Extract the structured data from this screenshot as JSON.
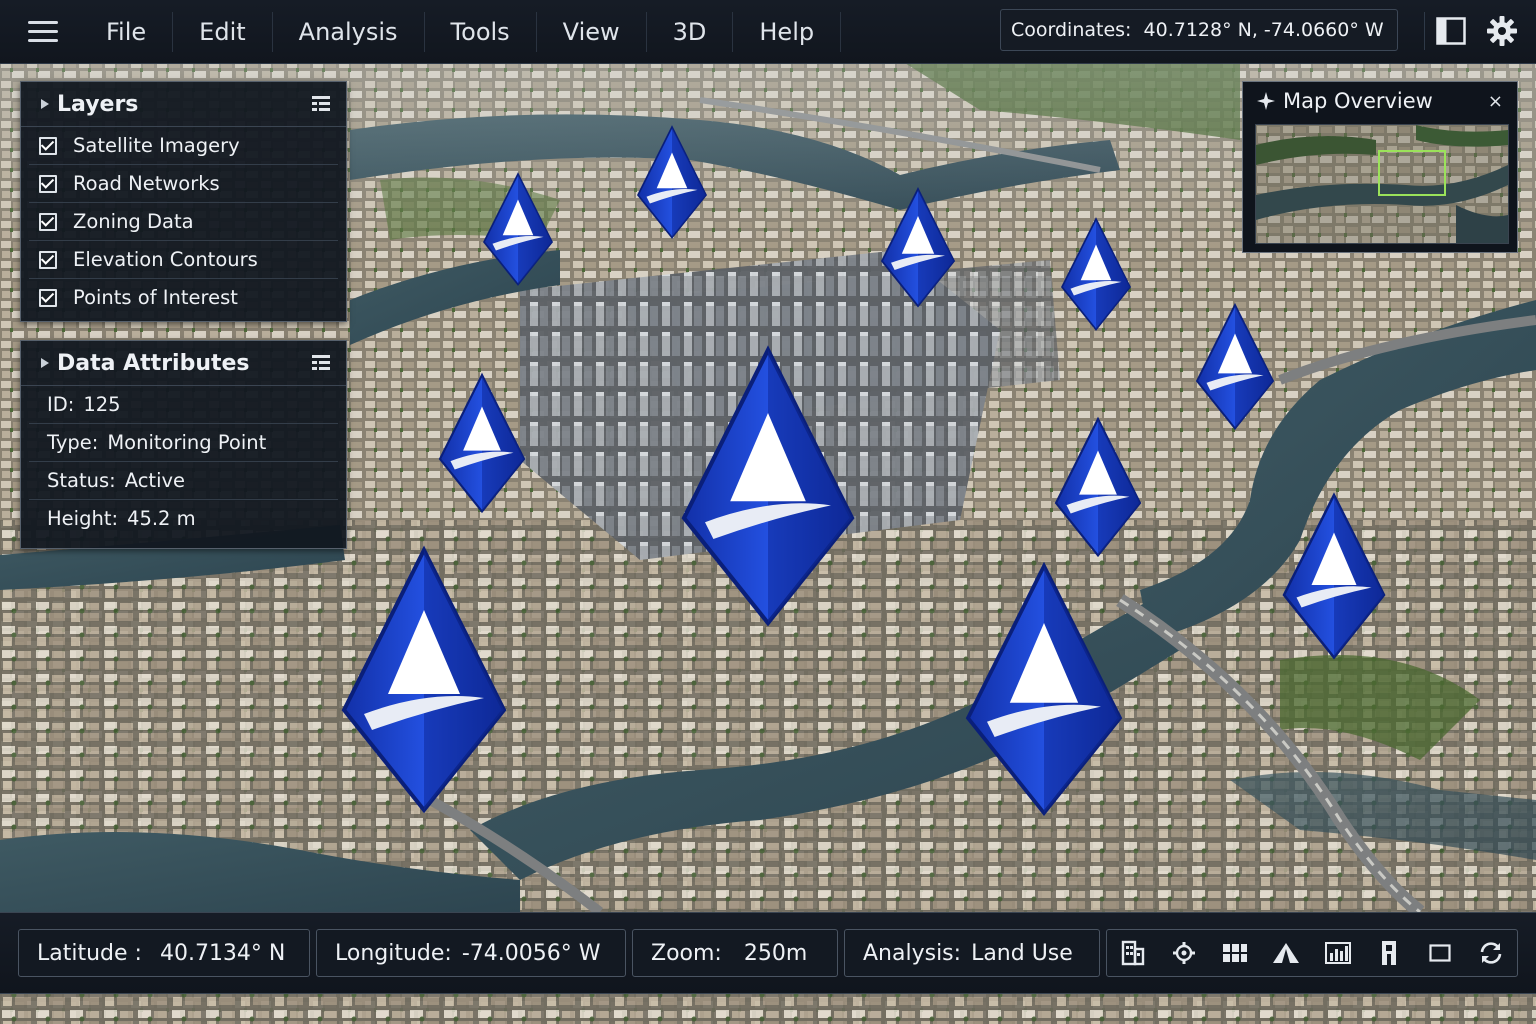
{
  "menu": {
    "items": [
      "File",
      "Edit",
      "Analysis",
      "Tools",
      "View",
      "3D",
      "Help"
    ],
    "coordinates_label": "Coordinates:",
    "coordinates_value": "40.7128° N, -74.0660° W"
  },
  "layers_panel": {
    "title": "Layers",
    "items": [
      {
        "label": "Satellite Imagery",
        "checked": true
      },
      {
        "label": "Road Networks",
        "checked": true
      },
      {
        "label": "Zoning Data",
        "checked": true
      },
      {
        "label": "Elevation Contours",
        "checked": true
      },
      {
        "label": "Points of Interest",
        "checked": true
      }
    ]
  },
  "attributes_panel": {
    "title": "Data Attributes",
    "rows": [
      {
        "key": "ID:",
        "value": "125"
      },
      {
        "key": "Type:",
        "value": "Monitoring Point"
      },
      {
        "key": "Status:",
        "value": "Active"
      },
      {
        "key": "Height:",
        "value": "45.2 m"
      }
    ]
  },
  "overview": {
    "title": "Map Overview",
    "close": "×"
  },
  "status": {
    "latitude_label": "Latitude :",
    "latitude_value": "40.7134° N",
    "longitude_label": "Longitude:",
    "longitude_value": "-74.0056° W",
    "zoom_label": "Zoom:",
    "zoom_value": "250m",
    "analysis_label": "Analysis:",
    "analysis_value": "Land Use"
  },
  "toolbar_icons": [
    "building-icon",
    "gear-icon",
    "grid-icon",
    "terrain-icon",
    "chart-icon",
    "tower-icon",
    "square-icon",
    "refresh-icon"
  ],
  "colors": {
    "marker_blue": "#1b3fc4",
    "marker_dark": "#0c2690",
    "viewport_green": "#9be25a",
    "bar_bg": "#11161e"
  }
}
